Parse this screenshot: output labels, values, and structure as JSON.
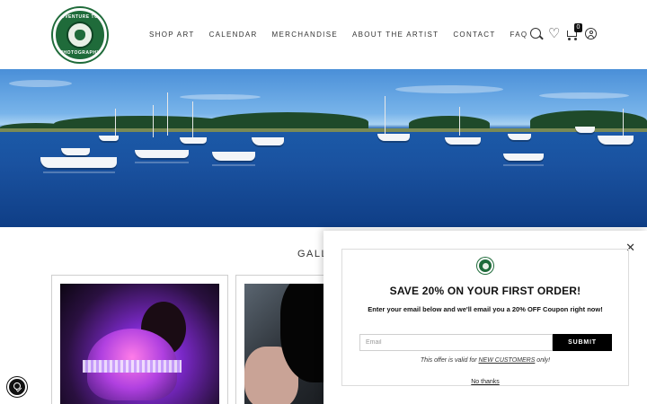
{
  "nav": {
    "items": [
      {
        "label": "SHOP ART"
      },
      {
        "label": "CALENDAR"
      },
      {
        "label": "MERCHANDISE"
      },
      {
        "label": "ABOUT THE ARTIST"
      },
      {
        "label": "CONTACT"
      },
      {
        "label": "FAQ"
      }
    ]
  },
  "header": {
    "logo_text_top": "ADVENTURE TOM",
    "logo_text_bottom": "PHOTOGRAPHY",
    "cart_count": "0",
    "icons": [
      "search-icon",
      "heart-icon",
      "cart-icon",
      "account-icon"
    ]
  },
  "gallery": {
    "heading": "GALLE"
  },
  "popup": {
    "title": "SAVE 20% ON YOUR FIRST ORDER!",
    "subtitle": "Enter your email below and we'll email you a 20% OFF Coupon right now!",
    "email_placeholder": "Email",
    "submit_label": "SUBMIT",
    "offer_prefix": "This offer is valid for ",
    "offer_link": "NEW CUSTOMERS",
    "offer_suffix": " only!",
    "no_thanks": "No thanks",
    "close_symbol": "✕"
  },
  "colors": {
    "brand_green": "#1f6b3a",
    "button_black": "#000000"
  }
}
